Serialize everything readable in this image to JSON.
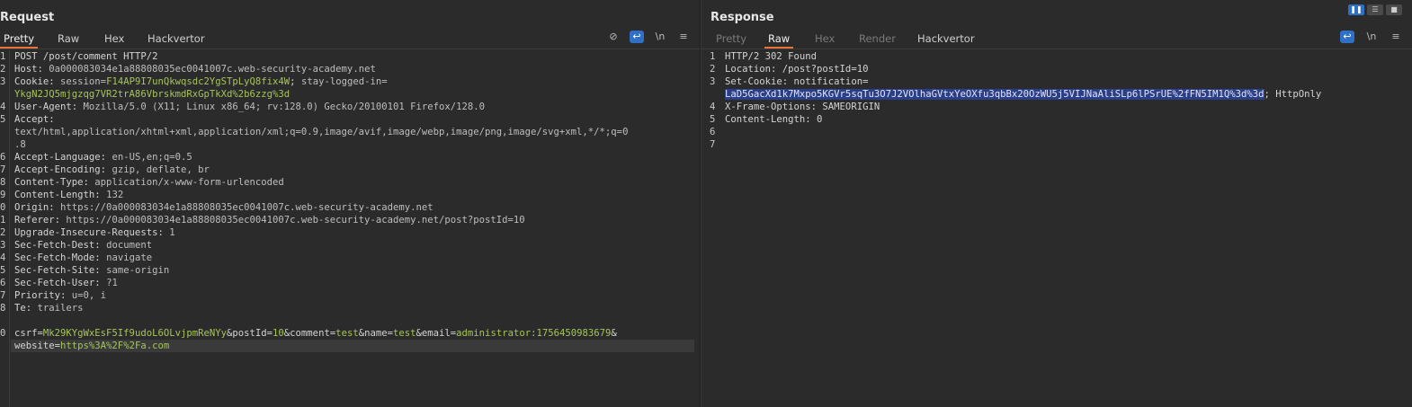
{
  "request": {
    "title": "Request",
    "tabs": [
      "Pretty",
      "Raw",
      "Hex",
      "Hackvertor"
    ],
    "active_tab": "Pretty",
    "icons": [
      "hide-nonprintable-icon",
      "wrap-lines-icon",
      "newline-icon",
      "menu-icon"
    ],
    "newline_label": "\\n",
    "line_numbers": [
      "1",
      "2",
      "3",
      "",
      "4",
      "5",
      "",
      "",
      "6",
      "7",
      "8",
      "9",
      "0",
      "1",
      "2",
      "3",
      "4",
      "5",
      "6",
      "7",
      "8",
      "",
      "0",
      ""
    ],
    "lines": [
      {
        "k": "POST /post/comment HTTP/2",
        "v": ""
      },
      {
        "k": "Host: ",
        "v": "0a000083034e1a88808035ec0041007c.web-security-academy.net"
      },
      {
        "k": "Cookie: ",
        "cookie1_name": "session=",
        "cookie1_val": "F14AP9I7unQkwqsdc2YgSTpLyQ8fix4W",
        "sep": "; ",
        "cookie2_name": "stay-logged-in="
      },
      {
        "k": "",
        "cookie2_val": "YkgN2JQ5mjgzqg7VR2trA86VbrskmdRxGpTkXd%2b6zzg%3d"
      },
      {
        "k": "User-Agent: ",
        "v": "Mozilla/5.0 (X11; Linux x86_64; rv:128.0) Gecko/20100101 Firefox/128.0"
      },
      {
        "k": "Accept:",
        "v": ""
      },
      {
        "k": "",
        "v": "text/html,application/xhtml+xml,application/xml;q=0.9,image/avif,image/webp,image/png,image/svg+xml,*/*;q=0"
      },
      {
        "k": "",
        "v": ".8"
      },
      {
        "k": "Accept-Language: ",
        "v": "en-US,en;q=0.5"
      },
      {
        "k": "Accept-Encoding: ",
        "v": "gzip, deflate, br"
      },
      {
        "k": "Content-Type: ",
        "v": "application/x-www-form-urlencoded"
      },
      {
        "k": "Content-Length: ",
        "v": "132"
      },
      {
        "k": "Origin: ",
        "v": "https://0a000083034e1a88808035ec0041007c.web-security-academy.net"
      },
      {
        "k": "Referer: ",
        "v": "https://0a000083034e1a88808035ec0041007c.web-security-academy.net/post?postId=10"
      },
      {
        "k": "Upgrade-Insecure-Requests: ",
        "v": "1"
      },
      {
        "k": "Sec-Fetch-Dest: ",
        "v": "document"
      },
      {
        "k": "Sec-Fetch-Mode: ",
        "v": "navigate"
      },
      {
        "k": "Sec-Fetch-Site: ",
        "v": "same-origin"
      },
      {
        "k": "Sec-Fetch-User: ",
        "v": "?1"
      },
      {
        "k": "Priority: ",
        "v": "u=0, i"
      },
      {
        "k": "Te: ",
        "v": "trailers"
      },
      {
        "k": "",
        "v": ""
      }
    ],
    "body": {
      "p1k": "csrf=",
      "p1v": "Mk29KYgWxEsF5If9udoL6OLvjpmReNYy",
      "p2k": "&postId=",
      "p2v": "10",
      "p3k": "&comment=",
      "p3v": "test",
      "p4k": "&name=",
      "p4v": "test",
      "p5k": "&email=",
      "p5v": "administrator:1756450983679",
      "p5tail": "&",
      "p6k": "website=",
      "p6v": "https%3A%2F%2Fa.com"
    }
  },
  "response": {
    "title": "Response",
    "tabs": [
      "Pretty",
      "Raw",
      "Hex",
      "Render",
      "Hackvertor"
    ],
    "active_tab": "Raw",
    "icons": [
      "wrap-lines-icon",
      "newline-icon",
      "menu-icon"
    ],
    "newline_label": "\\n",
    "line_numbers": [
      "1",
      "2",
      "3",
      "",
      "4",
      "5",
      "6",
      "7"
    ],
    "l1": "HTTP/2 302 Found",
    "l2": "Location: /post?postId=10",
    "l3": "Set-Cookie: notification=",
    "l3b_sel": "LaD5GacXd1k7Mxpo5KGVr5sqTu3O7J2VOlhaGVtxYeOXfu3qbBx20OzWU5j5VIJNaAliSLp6lPSrUE%2fFN5IM1Q%3d%3d",
    "l3b_tail": "; HttpOnly",
    "l4": "X-Frame-Options: SAMEORIGIN",
    "l5": "Content-Length: 0"
  },
  "layout_buttons": [
    "split-vertical-icon",
    "split-horizontal-icon",
    "single-pane-icon"
  ]
}
